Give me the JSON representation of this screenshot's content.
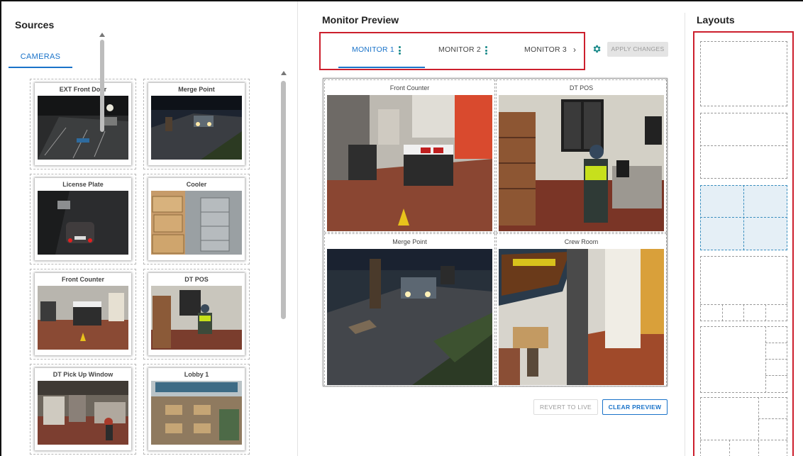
{
  "sources": {
    "title": "Sources",
    "tab": "CAMERAS",
    "cameras": [
      {
        "name": "EXT Front Door"
      },
      {
        "name": "Merge Point"
      },
      {
        "name": "License Plate"
      },
      {
        "name": "Cooler"
      },
      {
        "name": "Front Counter"
      },
      {
        "name": "DT POS"
      },
      {
        "name": "DT Pick Up Window"
      },
      {
        "name": "Lobby 1"
      }
    ]
  },
  "preview": {
    "title": "Monitor Preview",
    "tabs": [
      {
        "label": "MONITOR 1",
        "active": true
      },
      {
        "label": "MONITOR 2",
        "active": false
      },
      {
        "label": "MONITOR 3",
        "active": false
      }
    ],
    "next_icon": "chevron-right-icon",
    "settings_icon": "gear-icon",
    "apply_label": "APPLY CHANGES",
    "tiles": [
      {
        "name": "Front Counter"
      },
      {
        "name": "DT POS"
      },
      {
        "name": "Merge Point"
      },
      {
        "name": "Crew Room"
      }
    ],
    "revert_label": "REVERT TO LIVE",
    "clear_label": "CLEAR PREVIEW"
  },
  "layouts": {
    "title": "Layouts",
    "options": [
      {
        "name": "1x1",
        "selected": false
      },
      {
        "name": "1+1 vertical",
        "selected": false
      },
      {
        "name": "2x2",
        "selected": true
      },
      {
        "name": "1+4 bottom",
        "selected": false
      },
      {
        "name": "1+4 right",
        "selected": false
      },
      {
        "name": "1+5",
        "selected": false
      }
    ]
  },
  "colors": {
    "accent": "#1a73c9",
    "highlight_border": "#cc1f2d",
    "gear": "#1a8a8a",
    "selected_layout": "#e5eff6"
  }
}
